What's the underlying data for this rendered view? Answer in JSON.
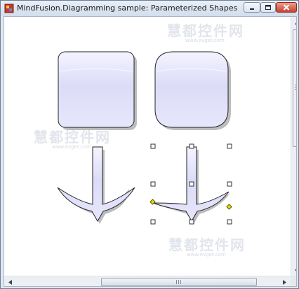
{
  "window": {
    "title": "MindFusion.Diagramming sample: Parameterized Shapes"
  },
  "watermarks": [
    {
      "text": "慧都控件网",
      "sub": "www.evget.com"
    },
    {
      "text": "慧都控件网",
      "sub": "www.evget.com"
    },
    {
      "text": "慧都控件网",
      "sub": "www.evget.com"
    }
  ],
  "shapes": [
    {
      "name": "Rounded Rectangle",
      "fill": "#dcdcf8",
      "stroke": "#222222"
    },
    {
      "name": "Rounded Square (large corners)",
      "fill": "#dcdcf8",
      "stroke": "#222222"
    },
    {
      "name": "Anchor",
      "fill": "#dcdcf8",
      "stroke": "#222222"
    },
    {
      "name": "Anchor (selected)",
      "fill": "#dcdcf8",
      "stroke": "#222222"
    }
  ],
  "colors": {
    "shape_fill": "#dcdcf8",
    "shape_stroke": "#222222",
    "shadow": "#bdbdbd",
    "handle_adjust": "#f0d800"
  },
  "icons": {
    "app": "diagram-app-icon",
    "minimize": "minimize-icon",
    "maximize": "maximize-icon",
    "close": "close-icon",
    "scroll_up": "scroll-up-arrow-icon",
    "scroll_down": "scroll-down-arrow-icon",
    "scroll_left": "scroll-left-arrow-icon",
    "scroll_right": "scroll-right-arrow-icon"
  }
}
